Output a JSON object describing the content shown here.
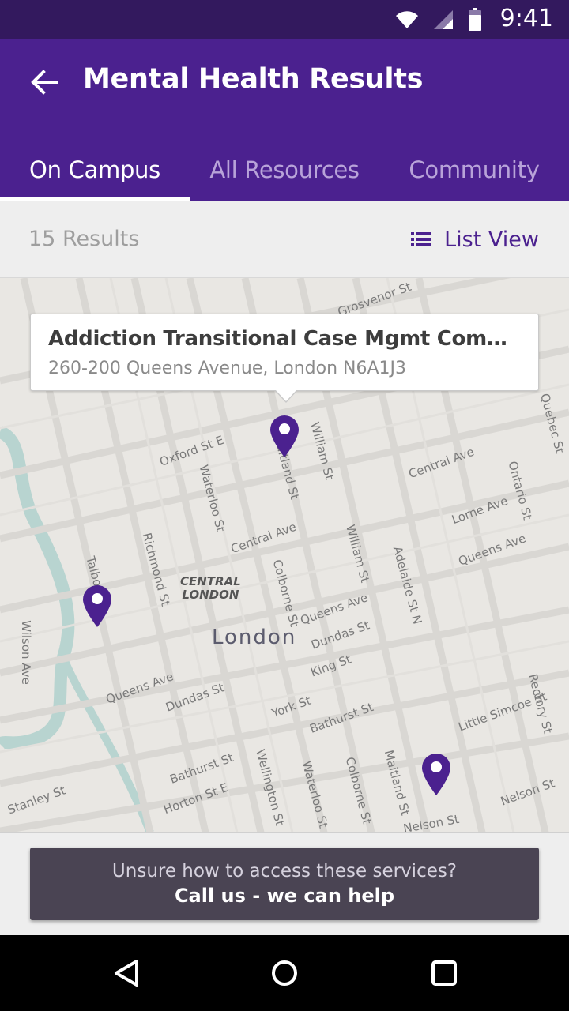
{
  "status_bar": {
    "time": "9:41",
    "icons": [
      "wifi-icon",
      "signal-icon",
      "battery-icon"
    ]
  },
  "app_bar": {
    "title": "Mental Health Results",
    "back_icon": "arrow-left-icon"
  },
  "tabs": [
    {
      "label": "On Campus",
      "selected": true
    },
    {
      "label": "All Resources",
      "selected": false
    },
    {
      "label": "Community",
      "selected": false
    }
  ],
  "results": {
    "count_label": "15 Results",
    "list_view_label": "List View",
    "list_view_icon": "list-icon"
  },
  "map": {
    "callout": {
      "title": "Addiction Transitional Case Mgmt Community Services",
      "address": "260-200 Queens Avenue, London  N6A1J3"
    },
    "city_label": "London",
    "district_label_line1": "CENTRAL",
    "district_label_line2": "LONDON",
    "street_labels": [
      "Oxford St E",
      "Waterloo St",
      "Maitland St",
      "William St",
      "Central Ave",
      "Central Ave",
      "Lorne Ave",
      "Queens Ave",
      "Ontario St",
      "Quebec St",
      "Richmond St",
      "Talbot St",
      "Colborne St",
      "William St",
      "Adelaide St N",
      "Queens Ave",
      "Dundas St",
      "King St",
      "Queens Ave",
      "Dundas St",
      "York St",
      "Bathurst St",
      "Little Simcoe St",
      "Rectory St",
      "Wilson Ave",
      "Bathurst St",
      "Horton St E",
      "Wellington St",
      "Waterloo St",
      "Colborne St",
      "Maitland St",
      "Nelson St",
      "Stanley St",
      "Grosvenor St",
      "Nelson St"
    ],
    "pins": [
      {
        "name": "map-pin-selected",
        "color": "#4b218f"
      },
      {
        "name": "map-pin-2",
        "color": "#4b218f"
      },
      {
        "name": "map-pin-3",
        "color": "#4b218f"
      }
    ]
  },
  "help": {
    "line1": "Unsure how to access these services?",
    "line2": "Call us - we can help"
  },
  "nav_bar": {
    "icons": [
      "back-triangle-icon",
      "home-circle-icon",
      "recents-square-icon"
    ]
  },
  "colors": {
    "primary": "#4b218f",
    "status_bar": "#33195e",
    "help_button": "#4a4453"
  }
}
